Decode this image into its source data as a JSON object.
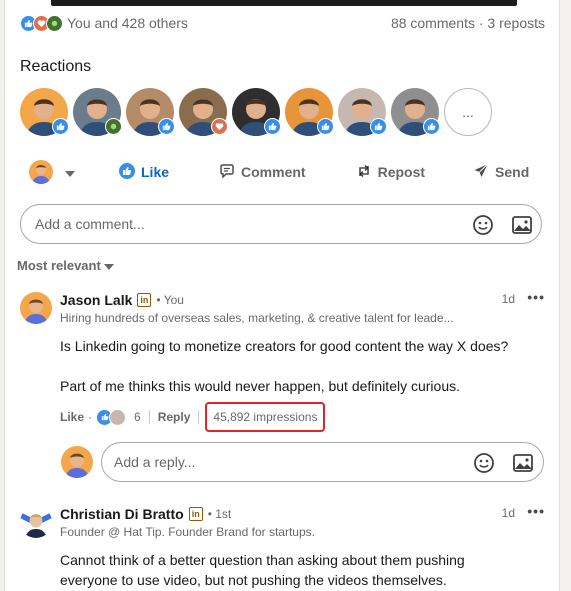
{
  "social": {
    "reactions_text": "You and 428 others",
    "comments_reposts": "88 comments · 3 reposts"
  },
  "reactions": {
    "title": "Reactions",
    "avatars": [
      {
        "reaction": "like",
        "bg": "#f3a64a"
      },
      {
        "reaction": "support",
        "bg": "#6b7c8c"
      },
      {
        "reaction": "like",
        "bg": "#b58c67"
      },
      {
        "reaction": "love",
        "bg": "#8a6d4e"
      },
      {
        "reaction": "like",
        "bg": "#2e2e2e"
      },
      {
        "reaction": "like",
        "bg": "#e8953a"
      },
      {
        "reaction": "like",
        "bg": "#c4b8b0"
      },
      {
        "reaction": "like",
        "bg": "#8f8f8f"
      }
    ],
    "more_label": "..."
  },
  "actions": {
    "like": "Like",
    "comment": "Comment",
    "repost": "Repost",
    "send": "Send"
  },
  "composer": {
    "placeholder": "Add a comment..."
  },
  "sort": {
    "label": "Most relevant"
  },
  "comments": [
    {
      "name": "Jason Lalk",
      "degree": "• You",
      "headline": "Hiring hundreds of overseas sales, marketing, & creative talent for leade...",
      "time": "1d",
      "text1": "Is Linkedin going to monetize creators for good content the way X does?",
      "text2": "Part of me thinks this would never happen, but definitely curious.",
      "like_label": "Like",
      "reaction_count": "6",
      "reply_label": "Reply",
      "impressions": "45,892 impressions"
    },
    {
      "name": "Christian Di Bratto",
      "degree": "• 1st",
      "headline": "Founder @ Hat Tip. Founder Brand for startups.",
      "time": "1d",
      "text1": "Cannot think of a better question than asking about them pushing",
      "text2": "everyone to use video, but not pushing the videos themselves."
    }
  ],
  "reply": {
    "placeholder": "Add a reply..."
  },
  "colors": {
    "like_blue": "#0a66c2",
    "highlight_red": "#e0242b",
    "support_green": "#44712e",
    "love_red": "#df704d"
  }
}
